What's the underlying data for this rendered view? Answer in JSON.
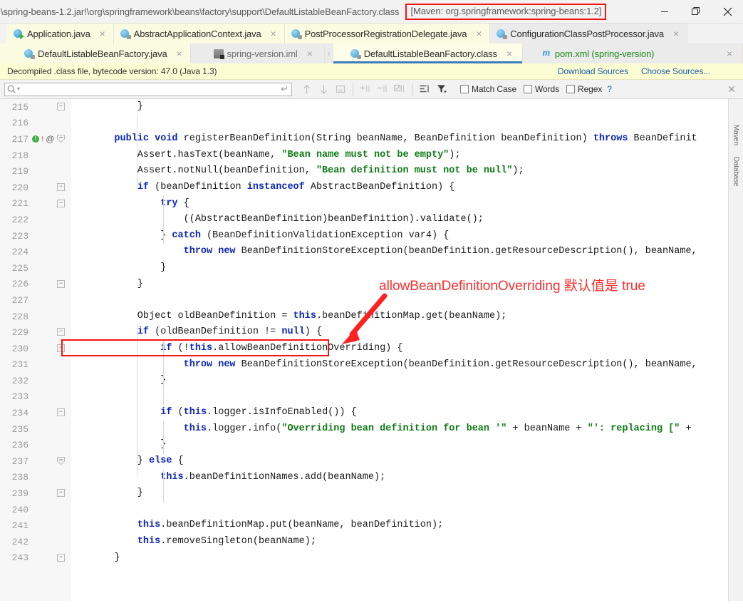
{
  "window": {
    "title_path": "\\spring-beans-1.2.jar!\\org\\springframework\\beans\\factory\\support\\DefaultListableBeanFactory.class",
    "maven_badge": "[Maven: org.springframework:spring-beans:1.2]",
    "controls": {
      "minimize": "minimize-button",
      "restore": "restore-button",
      "close": "close-button"
    }
  },
  "tabs": {
    "row1": [
      {
        "label": "Application.java",
        "icon": "java-run-icon",
        "state": "inactive",
        "bg": "yellow",
        "color": "dark"
      },
      {
        "label": "AbstractApplicationContext.java",
        "icon": "java-class-icon",
        "state": "inactive",
        "bg": "yellow",
        "color": "dark"
      },
      {
        "label": "PostProcessorRegistrationDelegate.java",
        "icon": "java-class-icon",
        "state": "inactive",
        "bg": "yellow",
        "color": "dark"
      },
      {
        "label": "ConfigurationClassPostProcessor.java",
        "icon": "java-class-icon",
        "state": "inactive",
        "bg": "yellow",
        "color": "dark"
      }
    ],
    "row2": [
      {
        "label": "DefaultListableBeanFactory.java",
        "icon": "java-class-icon",
        "state": "inactive",
        "bg": "yellow",
        "color": "dark"
      },
      {
        "label": "spring-version.iml",
        "icon": "iml-module-icon",
        "state": "inactive",
        "bg": "grey",
        "color": "grey"
      },
      {
        "label": "DefaultListableBeanFactory.class",
        "icon": "java-class-icon",
        "state": "active",
        "bg": "active",
        "color": "dark"
      },
      {
        "label": "pom.xml (spring-version)",
        "icon": "maven-m-icon",
        "state": "inactive",
        "bg": "grey",
        "color": "green"
      }
    ],
    "close_glyph": "×"
  },
  "notice": {
    "message": "Decompiled .class file, bytecode version: 47.0 (Java 1.3)",
    "links": [
      "Download Sources",
      "Choose Sources..."
    ]
  },
  "findbar": {
    "search_value": "",
    "search_placeholder": "",
    "icons": [
      "prev-occurrence-icon",
      "next-occurrence-icon",
      "select-all-icon",
      "add-line-icon",
      "remove-line-icon",
      "toggle-line-icon",
      "filter-lines-icon",
      "filter-icon"
    ],
    "options": [
      {
        "label": "Match Case",
        "mnemonic": "C",
        "checked": false
      },
      {
        "label": "Words",
        "mnemonic": "o",
        "checked": false
      },
      {
        "label": "Regex",
        "mnemonic": "x",
        "checked": false
      }
    ],
    "help_glyph": "?",
    "close_glyph": "✕"
  },
  "editor": {
    "first_line": 215,
    "lines": [
      {
        "n": 215,
        "fold": "minus",
        "icons": [],
        "tokens": [
          {
            "t": "        }",
            "c": "pl"
          }
        ]
      },
      {
        "n": 216,
        "fold": null,
        "icons": [],
        "tokens": []
      },
      {
        "n": 217,
        "fold": "tri",
        "icons": [
          "info-green-icon",
          "override-arrow-icon",
          "annotation-at-icon"
        ],
        "tokens": [
          {
            "t": "    ",
            "c": "pl"
          },
          {
            "t": "public void ",
            "c": "k"
          },
          {
            "t": "registerBeanDefinition(String beanName, BeanDefinition beanDefinition) ",
            "c": "pl"
          },
          {
            "t": "throws ",
            "c": "k"
          },
          {
            "t": "BeanDefinit",
            "c": "pl"
          }
        ]
      },
      {
        "n": 218,
        "fold": null,
        "icons": [],
        "tokens": [
          {
            "t": "        Assert.hasText(beanName, ",
            "c": "pl"
          },
          {
            "t": "\"Bean name must not be empty\"",
            "c": "s"
          },
          {
            "t": ");",
            "c": "pl"
          }
        ]
      },
      {
        "n": 219,
        "fold": null,
        "icons": [],
        "tokens": [
          {
            "t": "        Assert.notNull(beanDefinition, ",
            "c": "pl"
          },
          {
            "t": "\"Bean definition must not be null\"",
            "c": "s"
          },
          {
            "t": ");",
            "c": "pl"
          }
        ]
      },
      {
        "n": 220,
        "fold": "minus",
        "icons": [],
        "tokens": [
          {
            "t": "        ",
            "c": "pl"
          },
          {
            "t": "if ",
            "c": "k"
          },
          {
            "t": "(beanDefinition ",
            "c": "pl"
          },
          {
            "t": "instanceof ",
            "c": "k"
          },
          {
            "t": "AbstractBeanDefinition) {",
            "c": "pl"
          }
        ]
      },
      {
        "n": 221,
        "fold": "minus",
        "icons": [],
        "tokens": [
          {
            "t": "            ",
            "c": "pl"
          },
          {
            "t": "try ",
            "c": "k"
          },
          {
            "t": "{",
            "c": "pl"
          }
        ]
      },
      {
        "n": 222,
        "fold": null,
        "icons": [],
        "tokens": [
          {
            "t": "                ((AbstractBeanDefinition)beanDefinition).validate();",
            "c": "pl"
          }
        ]
      },
      {
        "n": 223,
        "fold": null,
        "icons": [],
        "tokens": [
          {
            "t": "            } ",
            "c": "pl"
          },
          {
            "t": "catch ",
            "c": "k"
          },
          {
            "t": "(BeanDefinitionValidationException var4) {",
            "c": "pl"
          }
        ]
      },
      {
        "n": 224,
        "fold": null,
        "icons": [],
        "tokens": [
          {
            "t": "                ",
            "c": "pl"
          },
          {
            "t": "throw new ",
            "c": "k"
          },
          {
            "t": "BeanDefinitionStoreException(beanDefinition.getResourceDescription(), beanName,",
            "c": "pl"
          }
        ]
      },
      {
        "n": 225,
        "fold": null,
        "icons": [],
        "tokens": [
          {
            "t": "            }",
            "c": "pl"
          }
        ]
      },
      {
        "n": 226,
        "fold": "minus",
        "icons": [],
        "tokens": [
          {
            "t": "        }",
            "c": "pl"
          }
        ]
      },
      {
        "n": 227,
        "fold": null,
        "icons": [],
        "tokens": []
      },
      {
        "n": 228,
        "fold": null,
        "icons": [],
        "tokens": [
          {
            "t": "        Object oldBeanDefinition = ",
            "c": "pl"
          },
          {
            "t": "this",
            "c": "k"
          },
          {
            "t": ".beanDefinitionMap.get(beanName);",
            "c": "pl"
          }
        ]
      },
      {
        "n": 229,
        "fold": "minus",
        "icons": [],
        "tokens": [
          {
            "t": "        ",
            "c": "pl"
          },
          {
            "t": "if ",
            "c": "k"
          },
          {
            "t": "(oldBeanDefinition != ",
            "c": "pl"
          },
          {
            "t": "null",
            "c": "k"
          },
          {
            "t": ") {",
            "c": "pl"
          }
        ]
      },
      {
        "n": 230,
        "fold": "minus",
        "icons": [],
        "tokens": [
          {
            "t": "            ",
            "c": "pl"
          },
          {
            "t": "if ",
            "c": "k"
          },
          {
            "t": "(!",
            "c": "pl"
          },
          {
            "t": "this",
            "c": "k"
          },
          {
            "t": ".allowBeanDefinitionOverriding) {",
            "c": "pl"
          }
        ]
      },
      {
        "n": 231,
        "fold": null,
        "icons": [],
        "tokens": [
          {
            "t": "                ",
            "c": "pl"
          },
          {
            "t": "throw new ",
            "c": "k"
          },
          {
            "t": "BeanDefinitionStoreException(beanDefinition.getResourceDescription(), beanName,",
            "c": "pl"
          }
        ]
      },
      {
        "n": 232,
        "fold": null,
        "icons": [],
        "tokens": [
          {
            "t": "            }",
            "c": "pl"
          }
        ]
      },
      {
        "n": 233,
        "fold": null,
        "icons": [],
        "tokens": []
      },
      {
        "n": 234,
        "fold": "minus",
        "icons": [],
        "tokens": [
          {
            "t": "            ",
            "c": "pl"
          },
          {
            "t": "if ",
            "c": "k"
          },
          {
            "t": "(",
            "c": "pl"
          },
          {
            "t": "this",
            "c": "k"
          },
          {
            "t": ".logger.isInfoEnabled()) {",
            "c": "pl"
          }
        ]
      },
      {
        "n": 235,
        "fold": null,
        "icons": [],
        "tokens": [
          {
            "t": "                ",
            "c": "pl"
          },
          {
            "t": "this",
            "c": "k"
          },
          {
            "t": ".logger.info(",
            "c": "pl"
          },
          {
            "t": "\"Overriding bean definition for bean '\"",
            "c": "s"
          },
          {
            "t": " + beanName + ",
            "c": "pl"
          },
          {
            "t": "\"': replacing [\"",
            "c": "s"
          },
          {
            "t": " +",
            "c": "pl"
          }
        ]
      },
      {
        "n": 236,
        "fold": null,
        "icons": [],
        "tokens": [
          {
            "t": "            }",
            "c": "pl"
          }
        ]
      },
      {
        "n": 237,
        "fold": "tri",
        "icons": [],
        "tokens": [
          {
            "t": "        } ",
            "c": "pl"
          },
          {
            "t": "else ",
            "c": "k"
          },
          {
            "t": "{",
            "c": "pl"
          }
        ]
      },
      {
        "n": 238,
        "fold": null,
        "icons": [],
        "tokens": [
          {
            "t": "            ",
            "c": "pl"
          },
          {
            "t": "this",
            "c": "k"
          },
          {
            "t": ".beanDefinitionNames.add(beanName);",
            "c": "pl"
          }
        ]
      },
      {
        "n": 239,
        "fold": "minus",
        "icons": [],
        "tokens": [
          {
            "t": "        }",
            "c": "pl"
          }
        ]
      },
      {
        "n": 240,
        "fold": null,
        "icons": [],
        "tokens": []
      },
      {
        "n": 241,
        "fold": null,
        "icons": [],
        "tokens": [
          {
            "t": "        ",
            "c": "pl"
          },
          {
            "t": "this",
            "c": "k"
          },
          {
            "t": ".beanDefinitionMap.put(beanName, beanDefinition);",
            "c": "pl"
          }
        ]
      },
      {
        "n": 242,
        "fold": null,
        "icons": [],
        "tokens": [
          {
            "t": "        ",
            "c": "pl"
          },
          {
            "t": "this",
            "c": "k"
          },
          {
            "t": ".removeSingleton(beanName);",
            "c": "pl"
          }
        ]
      },
      {
        "n": 243,
        "fold": "minus",
        "icons": [],
        "tokens": [
          {
            "t": "    }",
            "c": "pl"
          }
        ]
      }
    ]
  },
  "annotations": {
    "note_text": "allowBeanDefinitionOverriding 默认值是 true",
    "note_color": "#ff2d2d",
    "highlight_box_color": "#f31414",
    "highlighted_code": "if (!this.allowBeanDefinitionOverriding) {",
    "arrow_color": "#ff2020"
  },
  "right_strip": {
    "labels": [
      "Maven",
      "Database"
    ]
  }
}
